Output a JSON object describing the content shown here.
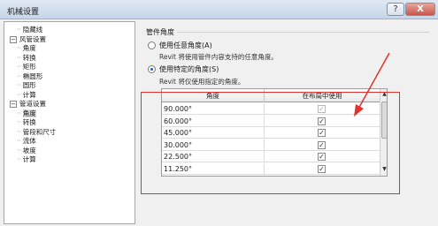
{
  "window": {
    "title": "机械设置",
    "help_label": "?",
    "close_label": "X"
  },
  "tree": {
    "items": [
      {
        "label": "隐藏线",
        "level": 1,
        "expander": ""
      },
      {
        "label": "风管设置",
        "level": 0,
        "expander": "−"
      },
      {
        "label": "角度",
        "level": 1,
        "expander": ""
      },
      {
        "label": "转换",
        "level": 1,
        "expander": ""
      },
      {
        "label": "矩形",
        "level": 1,
        "expander": ""
      },
      {
        "label": "椭圆形",
        "level": 1,
        "expander": ""
      },
      {
        "label": "圆形",
        "level": 1,
        "expander": ""
      },
      {
        "label": "计算",
        "level": 1,
        "expander": ""
      },
      {
        "label": "管道设置",
        "level": 0,
        "expander": "−"
      },
      {
        "label": "角度",
        "level": 1,
        "expander": "",
        "selected": true
      },
      {
        "label": "转换",
        "level": 1,
        "expander": ""
      },
      {
        "label": "管段和尺寸",
        "level": 1,
        "expander": ""
      },
      {
        "label": "流体",
        "level": 1,
        "expander": ""
      },
      {
        "label": "坡度",
        "level": 1,
        "expander": ""
      },
      {
        "label": "计算",
        "level": 1,
        "expander": ""
      }
    ]
  },
  "panel": {
    "group_label": "管件角度",
    "option_any": {
      "label": "使用任意角度(A)",
      "description": "Revit 将使用管件内容支持的任意角度。",
      "checked": false
    },
    "option_specific": {
      "label": "使用特定的角度(S)",
      "description": "Revit 将仅使用指定的角度。",
      "checked": true
    }
  },
  "table": {
    "headers": [
      "角度",
      "在布局中使用"
    ],
    "rows": [
      {
        "angle": "90.000°",
        "used": true,
        "disabled": true
      },
      {
        "angle": "60.000°",
        "used": true,
        "disabled": false
      },
      {
        "angle": "45.000°",
        "used": true,
        "disabled": false
      },
      {
        "angle": "30.000°",
        "used": true,
        "disabled": false
      },
      {
        "angle": "22.500°",
        "used": true,
        "disabled": false
      },
      {
        "angle": "11.250°",
        "used": true,
        "disabled": false
      }
    ]
  },
  "colors": {
    "annotation_red": "#e0332f",
    "selection_gray": "#dcdcdc"
  }
}
